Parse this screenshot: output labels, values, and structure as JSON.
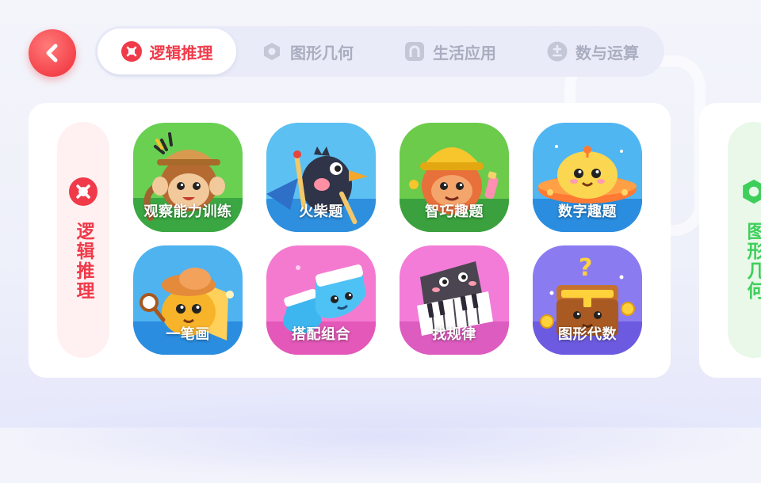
{
  "colors": {
    "accent": "#f03a4a",
    "tab_inactive": "#a9adbf",
    "category_next": "#3dcf5a"
  },
  "header": {
    "back_icon": "chevron-left-icon",
    "tabs": [
      {
        "label": "逻辑推理",
        "icon": "logic-icon",
        "active": true
      },
      {
        "label": "图形几何",
        "icon": "hexagon-icon",
        "active": false
      },
      {
        "label": "生活应用",
        "icon": "arch-icon",
        "active": false
      },
      {
        "label": "数与运算",
        "icon": "plus-minus-icon",
        "active": false
      }
    ]
  },
  "sections": [
    {
      "title": "逻辑推理",
      "games": [
        {
          "label": "观察能力训练",
          "icon": "monkey-explorer-icon"
        },
        {
          "label": "火柴题",
          "icon": "crow-matchstick-icon"
        },
        {
          "label": "智巧趣题",
          "icon": "builder-character-icon"
        },
        {
          "label": "数字趣题",
          "icon": "ufo-character-icon"
        },
        {
          "label": "一笔画",
          "icon": "detective-character-icon"
        },
        {
          "label": "搭配组合",
          "icon": "sock-character-icon"
        },
        {
          "label": "找规律",
          "icon": "piano-character-icon"
        },
        {
          "label": "图形代数",
          "icon": "treasure-chest-icon"
        }
      ]
    },
    {
      "title": "图形几何"
    }
  ]
}
